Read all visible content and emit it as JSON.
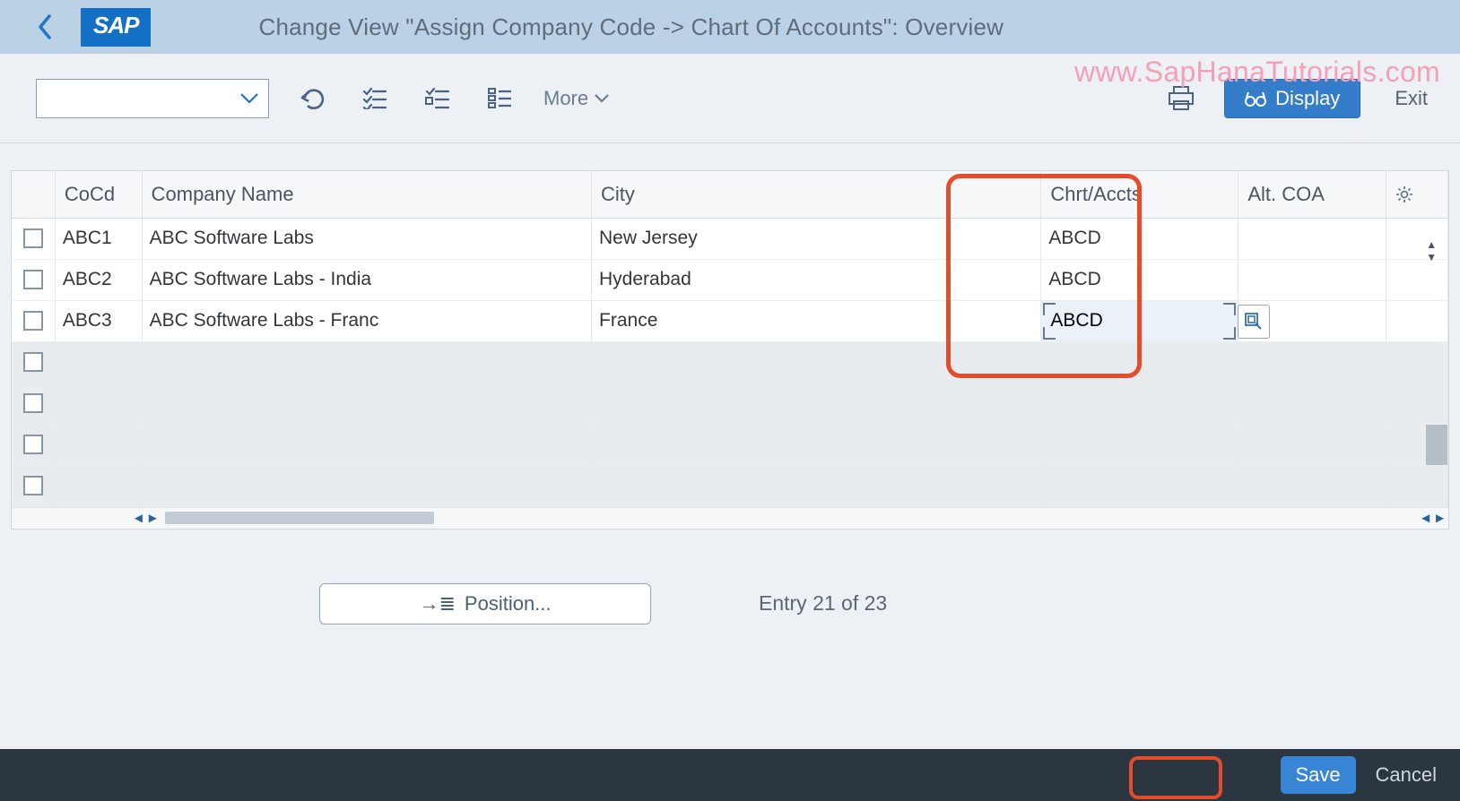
{
  "header": {
    "logo": "SAP",
    "title": "Change View \"Assign Company Code -> Chart Of Accounts\": Overview"
  },
  "watermark": "www.SapHanaTutorials.com",
  "toolbar": {
    "more_label": "More",
    "display_label": "Display",
    "exit_label": "Exit"
  },
  "table": {
    "headers": {
      "cocd": "CoCd",
      "company": "Company Name",
      "city": "City",
      "coa": "Chrt/Accts",
      "alt": "Alt. COA"
    },
    "rows": [
      {
        "cocd": "ABC1",
        "company": "ABC Software Labs",
        "city": "New Jersey",
        "coa": "ABCD",
        "alt": ""
      },
      {
        "cocd": "ABC2",
        "company": "ABC Software Labs - India",
        "city": "Hyderabad",
        "coa": "ABCD",
        "alt": ""
      },
      {
        "cocd": "ABC3",
        "company": "ABC Software Labs - Franc",
        "city": "France",
        "coa": "ABCD",
        "alt": ""
      }
    ],
    "empty_row_count": 4,
    "active_coa_row_index": 2
  },
  "position": {
    "button_label": "Position...",
    "entry_text": "Entry 21 of 23"
  },
  "footer": {
    "save": "Save",
    "cancel": "Cancel"
  }
}
